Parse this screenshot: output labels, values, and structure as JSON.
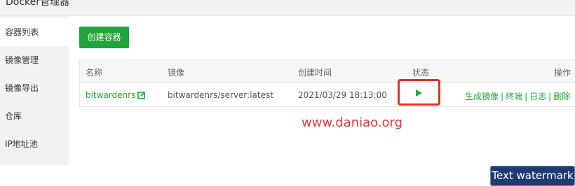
{
  "window": {
    "title": "Docker管理器"
  },
  "sidebar": {
    "items": [
      {
        "label": "容器列表",
        "active": true
      },
      {
        "label": "镜像管理",
        "active": false
      },
      {
        "label": "镜像导出",
        "active": false
      },
      {
        "label": "仓库",
        "active": false
      },
      {
        "label": "IP地址池",
        "active": false
      }
    ]
  },
  "toolbar": {
    "create_label": "创建容器"
  },
  "table": {
    "headers": {
      "name": "名称",
      "image": "镜像",
      "created": "创建时间",
      "status": "状态",
      "actions": "操作"
    },
    "rows": [
      {
        "name": "bitwardenrs",
        "image": "bitwardenrs/server:latest",
        "created": "2021/03/29 18:13:00",
        "status_icon": "play-icon",
        "actions": [
          "生成镜像",
          "终端",
          "日志",
          "删除"
        ]
      }
    ]
  },
  "watermarks": {
    "site": "www.daniao.org",
    "text": "Text watermark"
  },
  "colors": {
    "accent": "#20a53a",
    "highlight": "#d9332c",
    "sidebar_bg": "#f2f2f2"
  }
}
